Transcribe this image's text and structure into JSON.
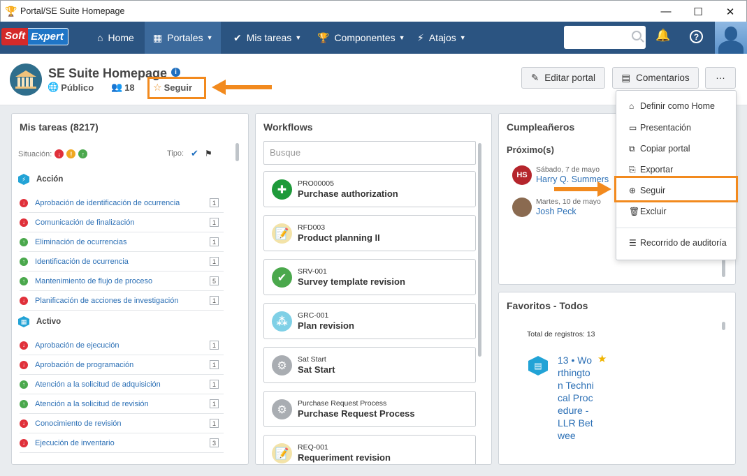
{
  "window": {
    "title": "Portal/SE Suite Homepage",
    "controls": [
      "—",
      "☐",
      "✕"
    ]
  },
  "brand": {
    "soft": "Soft",
    "expert": "Expert"
  },
  "nav": {
    "home": "Home",
    "portales": "Portales",
    "mis_tareas": "Mis tareas",
    "componentes": "Componentes",
    "atajos": "Atajos"
  },
  "portal": {
    "title": "SE Suite Homepage",
    "visibility": "Público",
    "members": "18",
    "follow": "Seguir",
    "edit_button": "Editar portal",
    "comments_button": "Comentarios",
    "more_button": "···"
  },
  "mis_tareas": {
    "title": "Mis tareas (8217)",
    "situacion": "Situación:",
    "tipo": "Tipo:",
    "groups": [
      {
        "name": "Acción",
        "tasks": [
          {
            "label": "Aprobación de identificación de ocurrencia",
            "status": "red",
            "count": "1"
          },
          {
            "label": "Comunicación de finalización",
            "status": "red",
            "count": "1"
          },
          {
            "label": "Eliminación de ocurrencias",
            "status": "green",
            "count": "1"
          },
          {
            "label": "Identificación de ocurrencia",
            "status": "green",
            "count": "1"
          },
          {
            "label": "Mantenimiento de flujo de proceso",
            "status": "green",
            "count": "5"
          },
          {
            "label": "Planificación de acciones de investigación",
            "status": "red",
            "count": "1"
          }
        ]
      },
      {
        "name": "Activo",
        "tasks": [
          {
            "label": "Aprobación de ejecución",
            "status": "red",
            "count": "1"
          },
          {
            "label": "Aprobación de programación",
            "status": "red",
            "count": "1"
          },
          {
            "label": "Atención a la solicitud de adquisición",
            "status": "green",
            "count": "1"
          },
          {
            "label": "Atención a la solicitud de revisión",
            "status": "green",
            "count": "1"
          },
          {
            "label": "Conocimiento de revisión",
            "status": "red",
            "count": "1"
          },
          {
            "label": "Ejecución de inventario",
            "status": "red",
            "count": "3"
          }
        ]
      }
    ]
  },
  "workflows": {
    "title": "Workflows",
    "search_placeholder": "Busque",
    "items": [
      {
        "code": "PRO00005",
        "name": "Purchase authorization",
        "icon": "plus-icon",
        "color": "#1e9a3a"
      },
      {
        "code": "RFD003",
        "name": "Product planning II",
        "icon": "clipboard-icon",
        "color": "#f3e3a8"
      },
      {
        "code": "SRV-001",
        "name": "Survey template revision",
        "icon": "check-icon",
        "color": "#4aa84c"
      },
      {
        "code": "GRC-001",
        "name": "Plan revision",
        "icon": "molecule-icon",
        "color": "#7fd0e6"
      },
      {
        "code": "Sat Start",
        "name": "Sat Start",
        "icon": "gear-icon",
        "color": "#a9adb2"
      },
      {
        "code": "Purchase Request Process",
        "name": "Purchase Request Process",
        "icon": "gear-icon",
        "color": "#a9adb2"
      },
      {
        "code": "REQ-001",
        "name": "Requeriment revision",
        "icon": "clipboard-icon",
        "color": "#f3e3a8"
      }
    ]
  },
  "cumpleaneros": {
    "title": "Cumpleañeros",
    "subtitle": "Próximo(s)",
    "people": [
      {
        "initials": "HS",
        "date": "Sábado, 7 de mayo",
        "name": "Harry Q. Summers",
        "color": "#b5252c"
      },
      {
        "initials": "",
        "date": "Martes, 10 de mayo",
        "name": "Josh Peck",
        "color": "#8a6a50"
      }
    ]
  },
  "menu": {
    "items": [
      {
        "label": "Definir como Home",
        "icon": "home-icon"
      },
      {
        "label": "Presentación",
        "icon": "presentation-icon"
      },
      {
        "label": "Copiar portal",
        "icon": "copy-icon"
      },
      {
        "label": "Exportar",
        "icon": "export-icon"
      },
      {
        "label": "Seguir",
        "icon": "plus-circle-icon"
      },
      {
        "label": "Excluir",
        "icon": "trash-icon"
      },
      {
        "label": "Recorrido de auditoría",
        "icon": "audit-icon"
      }
    ]
  },
  "favoritos": {
    "title": "Favoritos - Todos",
    "total": "Total de registros: 13",
    "item": "13 • Worthington Technical Procedure - LLR Betwee"
  },
  "colors": {
    "nav": "#2b5481",
    "highlight": "#f28a1e",
    "link": "#2b6fb5"
  }
}
